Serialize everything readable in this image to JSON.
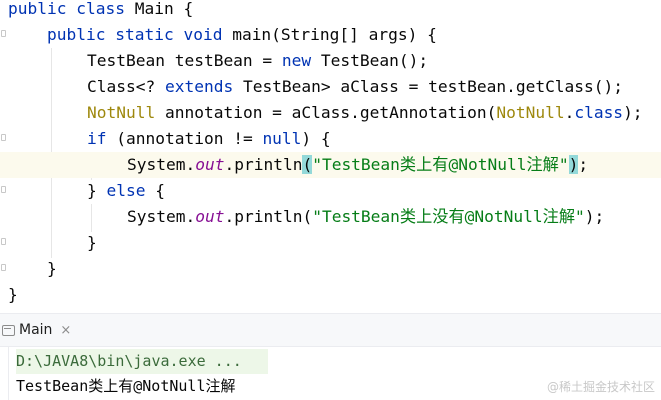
{
  "code": {
    "l1": {
      "kw1": "public",
      "kw2": "class",
      "rest": " Main {"
    },
    "l2": {
      "kw1": "public",
      "kw2": "static",
      "kw3": "void",
      "rest": " main(String[] args) {"
    },
    "l3": {
      "a": "TestBean testBean = ",
      "kw": "new",
      "b": " TestBean();"
    },
    "l4": {
      "a": "Class<? ",
      "kw": "extends",
      "b": " TestBean> aClass = testBean.getClass();"
    },
    "l5": {
      "ann1": "NotNull",
      "a": " annotation = aClass.getAnnotation(",
      "ann2": "NotNull",
      "dot": ".",
      "kw": "class",
      "b": ");"
    },
    "l6": {
      "kw1": "if",
      "a": " (annotation != ",
      "kw2": "null",
      "b": ") {"
    },
    "l7": {
      "a": "System.",
      "fld": "out",
      "b": ".println",
      "lp": "(",
      "str": "\"TestBean类上有@NotNull注解\"",
      "rp": ")",
      "c": ";"
    },
    "l8": {
      "a": "} ",
      "kw": "else",
      "b": " {"
    },
    "l9": {
      "a": "System.",
      "fld": "out",
      "b": ".println(",
      "str": "\"TestBean类上没有@NotNull注解\"",
      "c": ");"
    },
    "l10": {
      "a": "}"
    },
    "l11": {
      "a": "}"
    },
    "l12": {
      "a": "}"
    }
  },
  "run_tab": {
    "label": "Main",
    "close": "×"
  },
  "console": {
    "command": "D:\\JAVA8\\bin\\java.exe ...",
    "output": "TestBean类上有@NotNull注解"
  },
  "watermark": "@稀土掘金技术社区",
  "colors": {
    "keyword": "#0033b3",
    "string": "#067d17",
    "annotation": "#9e880d",
    "field": "#871094",
    "highlight_line": "#fcfaed",
    "brace_match": "#93d9d9"
  }
}
